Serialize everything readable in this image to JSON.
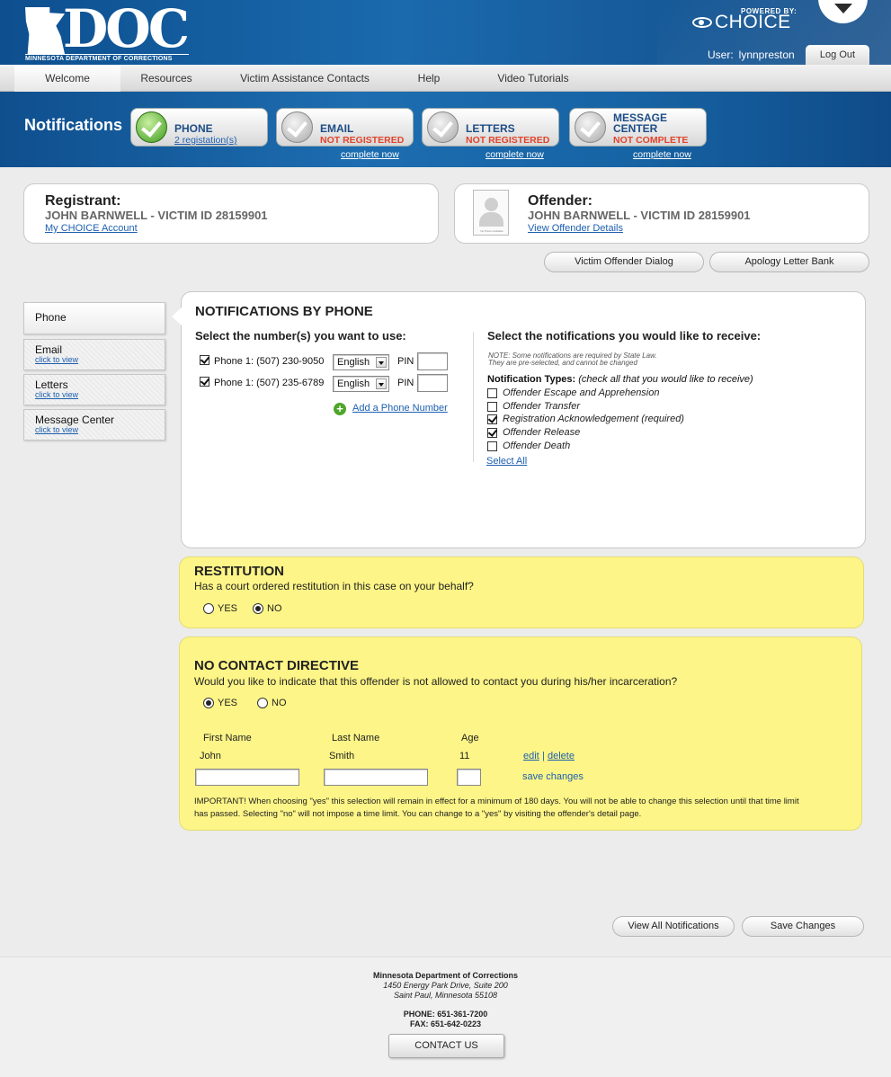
{
  "brand": {
    "logo_text": "DOC",
    "logo_subtitle": "MINNESOTA DEPARTMENT OF CORRECTIONS",
    "powered_by": "POWERED BY:",
    "choice_logo": "CHOICE"
  },
  "user": {
    "label": "User:",
    "name": "lynnpreston",
    "logout": "Log Out"
  },
  "nav": {
    "items": [
      {
        "label": "Welcome"
      },
      {
        "label": "Resources"
      },
      {
        "label": "Victim Assistance Contacts"
      },
      {
        "label": "Help"
      },
      {
        "label": "Video Tutorials"
      }
    ]
  },
  "notifications_bar": {
    "title": "Notifications",
    "steps": [
      {
        "label": "PHONE",
        "link": "2 registation(s)"
      },
      {
        "label": "EMAIL",
        "status": "NOT REGISTERED",
        "action": "complete now"
      },
      {
        "label": "LETTERS",
        "status": "NOT REGISTERED",
        "action": "complete now"
      },
      {
        "label_line1": "MESSAGE",
        "label_line2": "CENTER",
        "status": "NOT COMPLETE",
        "action": "complete now"
      }
    ]
  },
  "registrant": {
    "label": "Registrant:",
    "name": "JOHN BARNWELL - VICTIM ID 28159901",
    "link": "My CHOICE Account"
  },
  "offender": {
    "label": "Offender:",
    "name": "JOHN BARNWELL - VICTIM ID 28159901",
    "link": "View Offender Details",
    "photo_caption": "No Photo Available"
  },
  "actions": {
    "victim_offender_dialog": "Victim Offender Dialog",
    "apology_letter_bank": "Apology Letter Bank"
  },
  "sidebar": {
    "items": [
      {
        "label": "Phone"
      },
      {
        "label": "Email",
        "link": "click to view"
      },
      {
        "label": "Letters",
        "link": "click to view"
      },
      {
        "label": "Message Center",
        "link": "click to view"
      }
    ]
  },
  "phone_panel": {
    "title": "NOTIFICATIONS BY PHONE",
    "numbers_heading": "Select the number(s) you want to use:",
    "phones": [
      {
        "label": "Phone 1: (507) 230-9050",
        "language": "English",
        "pin_label": "PIN",
        "checked": true
      },
      {
        "label": "Phone 1: (507) 235-6789",
        "language": "English",
        "pin_label": "PIN",
        "checked": true
      }
    ],
    "add_phone": "Add a Phone Number",
    "notif_heading": "Select the notifications you would like to receive:",
    "note_line1": "NOTE: Some notifications are required by State Law.",
    "note_line2": "They are pre-selected, and cannot be changed",
    "types_bold": "Notification Types:",
    "types_italic": "(check all that you would like to receive)",
    "types": [
      {
        "label": "Offender Escape and Apprehension",
        "checked": false
      },
      {
        "label": "Offender Transfer",
        "checked": false
      },
      {
        "label": "Registration Acknowledgement (required)",
        "checked": true
      },
      {
        "label": "Offender Release",
        "checked": true
      },
      {
        "label": "Offender Death",
        "checked": false
      }
    ],
    "select_all": "Select All"
  },
  "restitution": {
    "title": "RESTITUTION",
    "question": "Has a court ordered restitution in this case on your behalf?",
    "yes": "YES",
    "no": "NO"
  },
  "no_contact": {
    "title": "NO CONTACT DIRECTIVE",
    "question": "Would you like to indicate that this offender is not allowed to contact you during his/her incarceration?",
    "yes": "YES",
    "no": "NO",
    "columns": {
      "first": "First Name",
      "last": "Last Name",
      "age": "Age"
    },
    "row": {
      "first": "John",
      "last": "Smith",
      "age": "11"
    },
    "edit": "edit",
    "separator": "|",
    "delete": "delete",
    "save_changes": "save changes",
    "important_line1": "IMPORTANT! When choosing \"yes\" this selection will remain in effect for a minimum of 180 days.  You will not be able to change this selection until that time limit",
    "important_line2": "has passed.  Selecting \"no\" will not impose a time limit.  You can change to a \"yes\" by visiting the offender's detail page."
  },
  "bottom_buttons": {
    "view_all": "View All Notifications",
    "save": "Save Changes"
  },
  "footer": {
    "org": "Minnesota Department of Corrections",
    "address1": "1450 Energy Park Drive, Suite 200",
    "address2": "Saint Paul, Minnesota 55108",
    "phone": "PHONE: 651-361-7200",
    "fax": "FAX: 651-642-0223",
    "contact": "CONTACT US"
  }
}
